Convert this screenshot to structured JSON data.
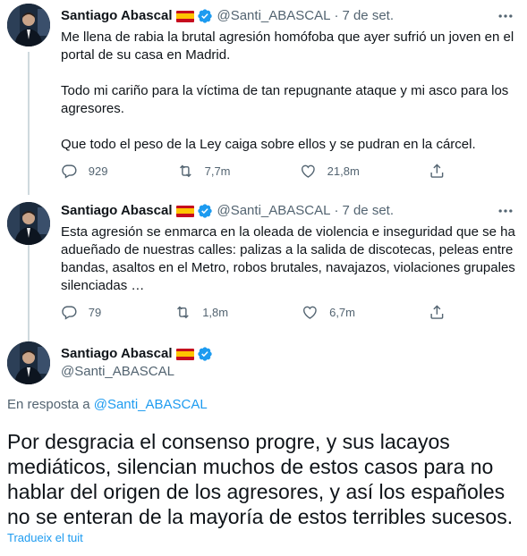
{
  "tweets": [
    {
      "name": "Santiago Abascal",
      "handle": "@Santi_ABASCAL",
      "date": "7 de set.",
      "paragraphs": [
        "Me llena de rabia la brutal agresión homófoba que ayer sufrió un joven en el portal de su casa en Madrid.",
        "Todo mi cariño para la víctima de tan repugnante ataque y mi asco para los agresores.",
        "Que todo el peso de la Ley caiga sobre ellos y se pudran en la cárcel."
      ],
      "replies": "929",
      "retweets": "7,7m",
      "likes": "21,8m"
    },
    {
      "name": "Santiago Abascal",
      "handle": "@Santi_ABASCAL",
      "date": "7 de set.",
      "paragraphs": [
        "Esta agresión se enmarca en la oleada de violencia e inseguridad que se ha adueñado de nuestras calles: palizas a la salida de discotecas, peleas entre bandas, asaltos en el Metro, robos brutales, navajazos, violaciones grupales silenciadas …"
      ],
      "replies": "79",
      "retweets": "1,8m",
      "likes": "6,7m"
    }
  ],
  "main": {
    "name": "Santiago Abascal",
    "handle": "@Santi_ABASCAL",
    "reply_prefix": "En resposta a ",
    "reply_handle": "@Santi_ABASCAL",
    "text": "Por desgracia el consenso progre, y sus lacayos mediáticos, silencian  muchos de estos casos para no hablar del origen de los agresores, y así los españoles no se enteran de la mayoría de estos terribles sucesos.",
    "translate_label": "Tradueix el tuit"
  },
  "icons": {
    "reply": "reply-icon",
    "retweet": "retweet-icon",
    "like": "heart-icon",
    "share": "share-icon",
    "more": "more-icon",
    "verified": "verified-badge-icon",
    "flag": "spain-flag-icon"
  },
  "colors": {
    "accent": "#1d9bf0",
    "secondary_text": "#536471",
    "thread_line": "#cfd9de"
  }
}
